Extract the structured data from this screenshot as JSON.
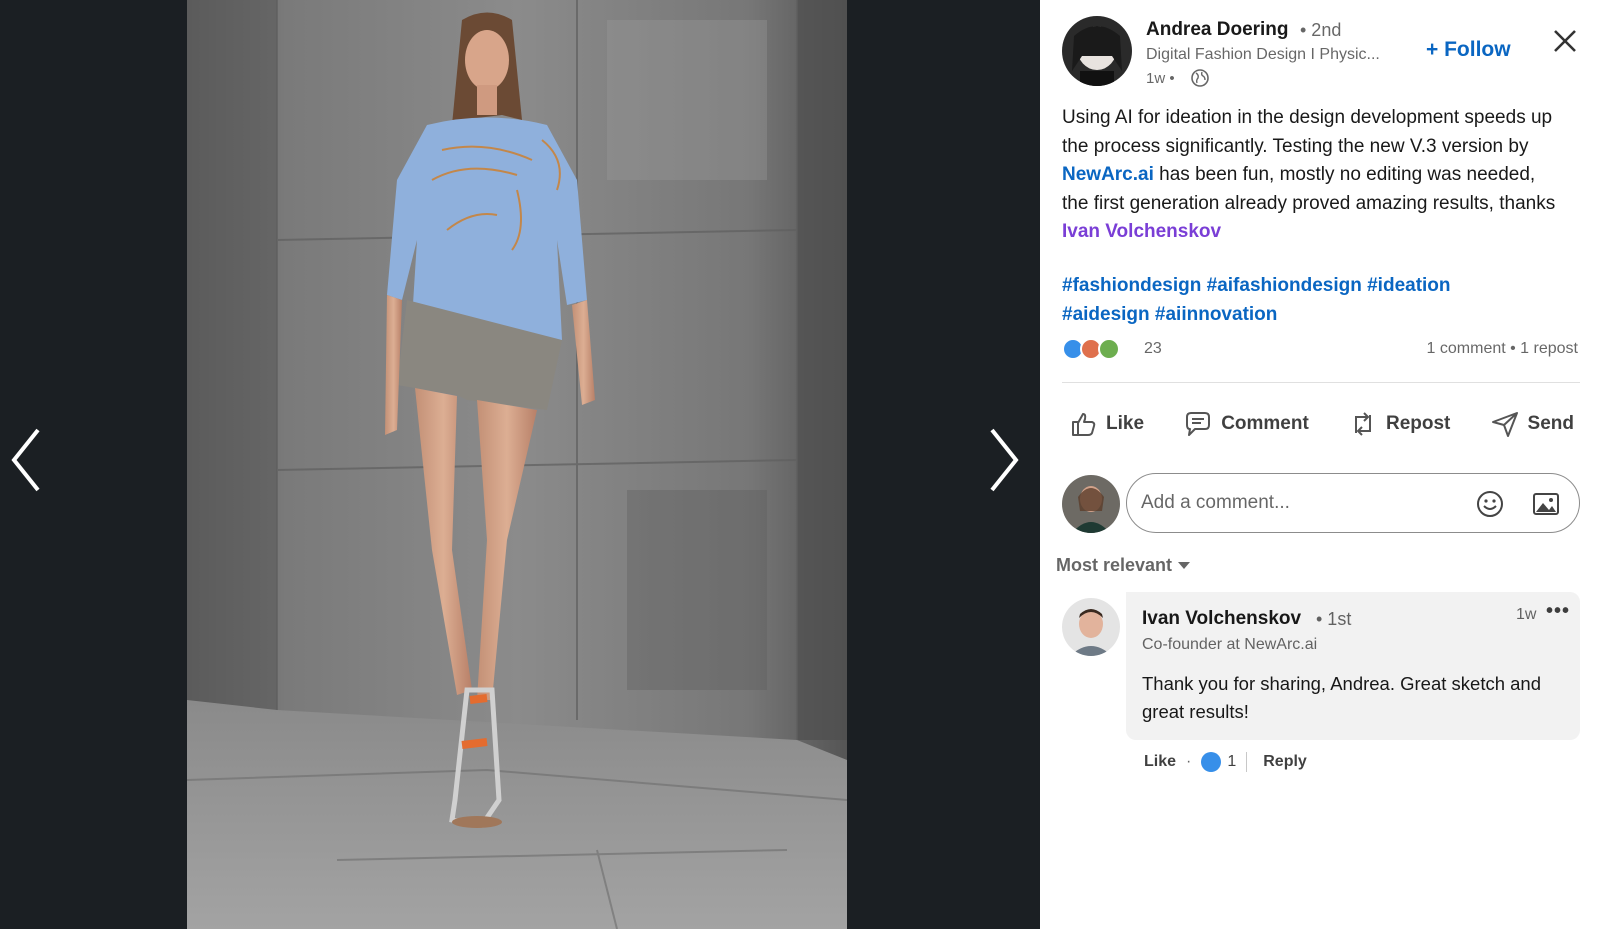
{
  "viewer": {
    "prev_label": "Previous image",
    "next_label": "Next image"
  },
  "post": {
    "author_name": "Andrea Doering",
    "author_degree": "• 2nd",
    "author_headline": "Digital Fashion Design I Physic...",
    "time": "1w •",
    "follow_label": "+ Follow",
    "text_part1": "Using AI for ideation in the design development speeds up the process significantly. Testing the new V.3 version by ",
    "link_text": "NewArc.ai",
    "text_part2": " has been fun, mostly no editing was needed, the first generation already proved amazing results, thanks ",
    "mention_text": "Ivan Volchenskov",
    "hashtags_line1": "#fashiondesign #aifashiondesign #ideation",
    "hashtags_line2": "#aidesign #aiinnovation",
    "reaction_count": "23",
    "stats": "1 comment • 1 repost"
  },
  "actions": {
    "like": "Like",
    "comment": "Comment",
    "repost": "Repost",
    "send": "Send"
  },
  "comment_input": {
    "placeholder": "Add a comment..."
  },
  "sort": {
    "label": "Most relevant"
  },
  "comment": {
    "name": "Ivan Volchenskov",
    "degree": "• 1st",
    "headline": "Co-founder at NewArc.ai",
    "time": "1w",
    "more": "•••",
    "text": "Thank you for sharing, Andrea. Great sketch and great results!",
    "like_label": "Like",
    "dot": "·",
    "reaction_count": "1",
    "reply_label": "Reply"
  },
  "colors": {
    "link_blue": "#0a66c2",
    "mention_purple": "#7a3ed6",
    "viewer_bg": "#1b1f23"
  }
}
